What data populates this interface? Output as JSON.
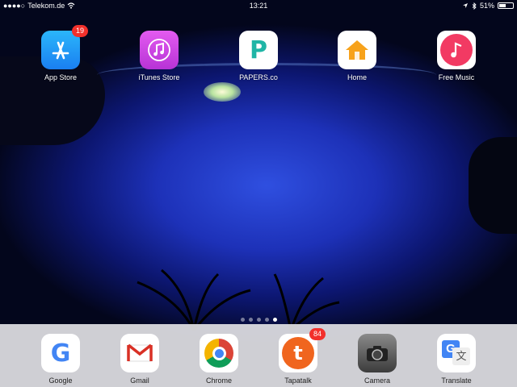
{
  "status_bar": {
    "carrier": "Telekom.de",
    "time": "13:21",
    "battery_percent": "51%",
    "battery_level": 0.51,
    "wifi_icon": "wifi-icon",
    "location_icon": "location-arrow-icon",
    "bluetooth_icon": "bluetooth-icon"
  },
  "home_apps": [
    {
      "label": "App Store",
      "badge": "19",
      "icon": "app-store-icon",
      "color": "#1e9ef5"
    },
    {
      "label": "iTunes Store",
      "badge": null,
      "icon": "itunes-store-icon",
      "color": "#c83fe0"
    },
    {
      "label": "PAPERS.co",
      "badge": null,
      "icon": "papers-icon",
      "color": "#ffffff"
    },
    {
      "label": "Home",
      "badge": null,
      "icon": "home-icon",
      "color": "#ffffff"
    },
    {
      "label": "Free Music",
      "badge": null,
      "icon": "free-music-icon",
      "color": "#f23a63"
    }
  ],
  "page_indicator": {
    "pages": 5,
    "current": 5
  },
  "dock_apps": [
    {
      "label": "Google",
      "badge": null,
      "icon": "google-icon",
      "color": "#ffffff"
    },
    {
      "label": "Gmail",
      "badge": null,
      "icon": "gmail-icon",
      "color": "#ffffff"
    },
    {
      "label": "Chrome",
      "badge": null,
      "icon": "chrome-icon",
      "color": "#ffffff"
    },
    {
      "label": "Tapatalk",
      "badge": "84",
      "icon": "tapatalk-icon",
      "color": "#f0651e"
    },
    {
      "label": "Camera",
      "badge": null,
      "icon": "camera-icon",
      "color": "#555555"
    },
    {
      "label": "Translate",
      "badge": null,
      "icon": "translate-icon",
      "color": "#ffffff"
    }
  ]
}
